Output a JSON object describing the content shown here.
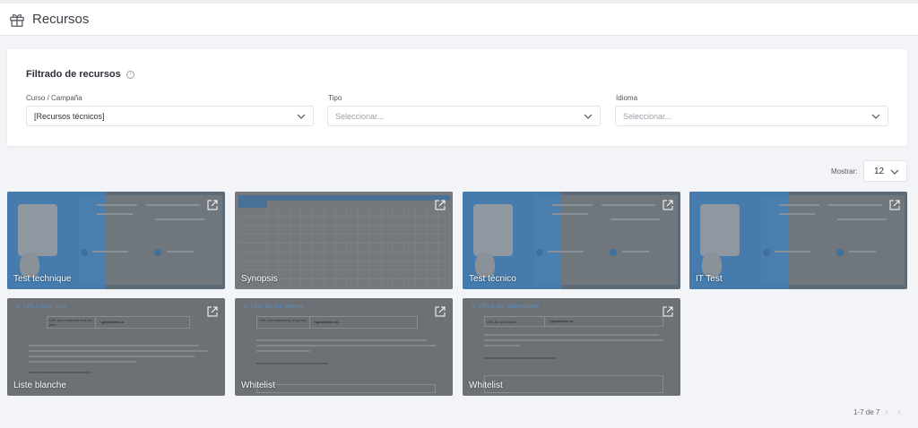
{
  "header": {
    "title": "Recursos",
    "icon": "gift-icon"
  },
  "filters": {
    "title": "Filtrado de recursos",
    "fields": [
      {
        "label": "Curso / Campaña",
        "value": "[Recursos técnicos]",
        "placeholder": ""
      },
      {
        "label": "Tipo",
        "value": "",
        "placeholder": "Seleccionar..."
      },
      {
        "label": "Idioma",
        "value": "",
        "placeholder": "Seleccionar..."
      }
    ]
  },
  "pagination": {
    "show_label": "Mostrar:",
    "page_size": "12",
    "range": "1-7 de 7"
  },
  "resources": [
    {
      "label": "Test technique",
      "kind": "blue"
    },
    {
      "label": "Synopsis",
      "kind": "table"
    },
    {
      "label": "Test técnico",
      "kind": "blue"
    },
    {
      "label": "IT Test",
      "kind": "blue"
    },
    {
      "label": "Liste blanche",
      "kind": "doc",
      "heading": "1. URLs pour jeux",
      "field_label": "URL qui comprend tous les jeux",
      "field_value": "*.gamelearn.io"
    },
    {
      "label": "Whitelist",
      "kind": "doc",
      "heading": "1. URL for the games",
      "field_label": "URL encompassing all games",
      "field_value": "*.gamelearn.io"
    },
    {
      "label": "Whitelist",
      "kind": "doc",
      "heading": "1. URLs der Videospiele",
      "field_label": "URL für alle Spiele",
      "field_value": "*.gamelearn.io"
    }
  ],
  "colors": {
    "accent": "#3d82bf",
    "background": "#f3f4f7",
    "overlay": "#6d7175"
  }
}
